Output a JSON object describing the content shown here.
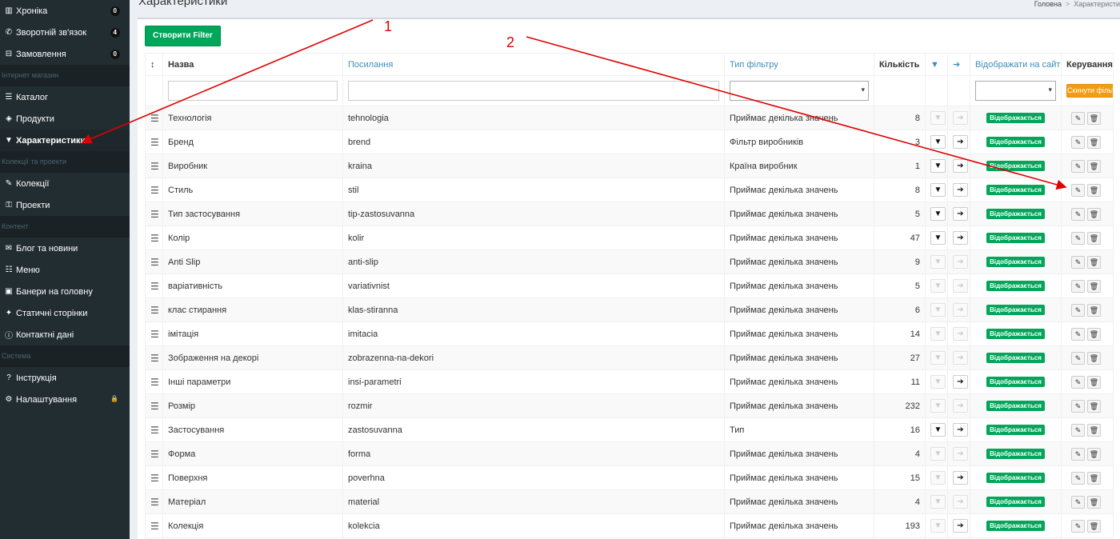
{
  "sidebar": {
    "items": [
      {
        "type": "item",
        "icon": "bar-chart-icon",
        "glyph": "▥",
        "label": "Хроніка",
        "badge": "0"
      },
      {
        "type": "item",
        "icon": "phone-icon",
        "glyph": "✆",
        "label": "Зворотній зв'язок",
        "badge": "4"
      },
      {
        "type": "item",
        "icon": "basket-icon",
        "glyph": "⊟",
        "label": "Замовлення",
        "badge": "0"
      },
      {
        "type": "header",
        "label": "Інтернет магазин"
      },
      {
        "type": "item",
        "icon": "list-icon",
        "glyph": "☰",
        "label": "Каталог"
      },
      {
        "type": "item",
        "icon": "cube-icon",
        "glyph": "◈",
        "label": "Продукти"
      },
      {
        "type": "item",
        "icon": "filter-icon",
        "glyph": "▼",
        "label": "Характеристики",
        "active": true
      },
      {
        "type": "header",
        "label": "Колекції та проекти"
      },
      {
        "type": "item",
        "icon": "magic-icon",
        "glyph": "✎",
        "label": "Колекції"
      },
      {
        "type": "item",
        "icon": "unlock-icon",
        "glyph": "⚿",
        "label": "Проекти"
      },
      {
        "type": "header",
        "label": "Контент"
      },
      {
        "type": "item",
        "icon": "bullhorn-icon",
        "glyph": "✉",
        "label": "Блог та новини"
      },
      {
        "type": "item",
        "icon": "menu-icon",
        "glyph": "☷",
        "label": "Меню"
      },
      {
        "type": "item",
        "icon": "image-icon",
        "glyph": "▣",
        "label": "Банери на головну"
      },
      {
        "type": "item",
        "icon": "pin-icon",
        "glyph": "✦",
        "label": "Статичні сторінки"
      },
      {
        "type": "item",
        "icon": "info-icon",
        "glyph": "ⓘ",
        "label": "Контактні дані"
      },
      {
        "type": "header",
        "label": "Система"
      },
      {
        "type": "item",
        "icon": "question-icon",
        "glyph": "?",
        "label": "Інструкція"
      },
      {
        "type": "item",
        "icon": "gear-icon",
        "glyph": "⚙",
        "label": "Налаштування",
        "lock": true
      }
    ]
  },
  "header": {
    "title": "Характеристики",
    "breadcrumb_home": "Головна",
    "breadcrumb_sep": ">",
    "breadcrumb_current": "Характеристи"
  },
  "toolbar": {
    "create_label": "Створити Filter"
  },
  "table": {
    "columns": {
      "sort": "↕",
      "name": "Назва",
      "slug": "Посилання",
      "type": "Тип фільтру",
      "count": "Кількість",
      "filter_icon": "▼",
      "arrow_icon": "➔",
      "visible": "Відображати на сайті",
      "manage": "Керування"
    },
    "reset_label": "Скинути фільтр",
    "rows": [
      {
        "name": "Технологія",
        "slug": "tehnologia",
        "type": "Приймає декілька значень",
        "count": "8",
        "filter_on": false,
        "arrow_on": false,
        "status": "Відображається"
      },
      {
        "name": "Бренд",
        "slug": "brend",
        "type": "Фільтр виробників",
        "count": "3",
        "filter_on": true,
        "arrow_on": true,
        "status": "Відображається"
      },
      {
        "name": "Виробник",
        "slug": "kraina",
        "type": "Країна виробник",
        "count": "1",
        "filter_on": true,
        "arrow_on": true,
        "status": "Відображається"
      },
      {
        "name": "Стиль",
        "slug": "stil",
        "type": "Приймає декілька значень",
        "count": "8",
        "filter_on": true,
        "arrow_on": true,
        "status": "Відображається"
      },
      {
        "name": "Тип застосування",
        "slug": "tip-zastosuvanna",
        "type": "Приймає декілька значень",
        "count": "5",
        "filter_on": true,
        "arrow_on": true,
        "status": "Відображається"
      },
      {
        "name": "Колір",
        "slug": "kolir",
        "type": "Приймає декілька значень",
        "count": "47",
        "filter_on": true,
        "arrow_on": true,
        "status": "Відображається"
      },
      {
        "name": "Anti Slip",
        "slug": "anti-slip",
        "type": "Приймає декілька значень",
        "count": "9",
        "filter_on": false,
        "arrow_on": false,
        "status": "Відображається"
      },
      {
        "name": "варіативність",
        "slug": "variativnist",
        "type": "Приймає декілька значень",
        "count": "5",
        "filter_on": false,
        "arrow_on": false,
        "status": "Відображається"
      },
      {
        "name": "клас стирання",
        "slug": "klas-stiranna",
        "type": "Приймає декілька значень",
        "count": "6",
        "filter_on": false,
        "arrow_on": false,
        "status": "Відображається"
      },
      {
        "name": "імітація",
        "slug": "imitacia",
        "type": "Приймає декілька значень",
        "count": "14",
        "filter_on": false,
        "arrow_on": false,
        "status": "Відображається"
      },
      {
        "name": "Зображення на декорі",
        "slug": "zobrazenna-na-dekori",
        "type": "Приймає декілька значень",
        "count": "27",
        "filter_on": false,
        "arrow_on": false,
        "status": "Відображається"
      },
      {
        "name": "Інші параметри",
        "slug": "insi-parametri",
        "type": "Приймає декілька значень",
        "count": "11",
        "filter_on": false,
        "arrow_on": true,
        "status": "Відображається"
      },
      {
        "name": "Розмір",
        "slug": "rozmir",
        "type": "Приймає декілька значень",
        "count": "232",
        "filter_on": false,
        "arrow_on": false,
        "status": "Відображається"
      },
      {
        "name": "Застосування",
        "slug": "zastosuvanna",
        "type": "Тип",
        "count": "16",
        "filter_on": true,
        "arrow_on": true,
        "status": "Відображається"
      },
      {
        "name": "Форма",
        "slug": "forma",
        "type": "Приймає декілька значень",
        "count": "4",
        "filter_on": false,
        "arrow_on": false,
        "status": "Відображається"
      },
      {
        "name": "Поверхня",
        "slug": "poverhna",
        "type": "Приймає декілька значень",
        "count": "15",
        "filter_on": false,
        "arrow_on": true,
        "status": "Відображається"
      },
      {
        "name": "Матеріал",
        "slug": "material",
        "type": "Приймає декілька значень",
        "count": "4",
        "filter_on": false,
        "arrow_on": false,
        "status": "Відображається"
      },
      {
        "name": "Колекція",
        "slug": "kolekcia",
        "type": "Приймає декілька значень",
        "count": "193",
        "filter_on": false,
        "arrow_on": true,
        "status": "Відображається"
      }
    ]
  },
  "annotations": [
    {
      "label": "1"
    },
    {
      "label": "2"
    }
  ],
  "colors": {
    "sidebar_bg": "#222d32",
    "primary_link": "#3c8dbc",
    "success": "#00a65a",
    "warning": "#f39c12",
    "annotation": "#e00000"
  }
}
